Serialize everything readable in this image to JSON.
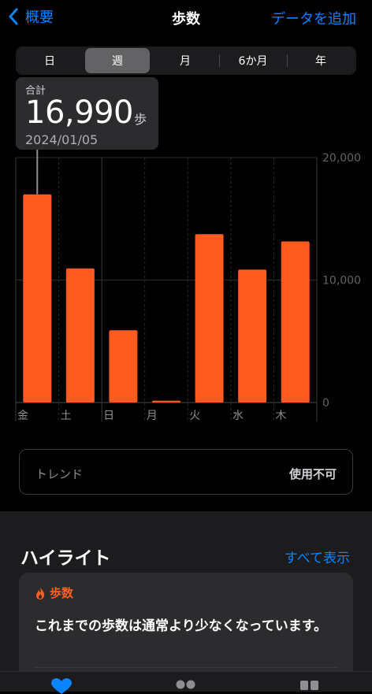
{
  "nav": {
    "back_label": "概要",
    "title": "歩数",
    "add_label": "データを追加"
  },
  "segments": [
    {
      "label": "日",
      "selected": false
    },
    {
      "label": "週",
      "selected": true
    },
    {
      "label": "月",
      "selected": false
    },
    {
      "label": "6か月",
      "selected": false
    },
    {
      "label": "年",
      "selected": false
    }
  ],
  "tooltip": {
    "label": "合計",
    "value": "16,990",
    "unit": "歩",
    "date": "2024/01/05"
  },
  "chart_data": {
    "type": "bar",
    "categories": [
      "金",
      "土",
      "日",
      "月",
      "火",
      "水",
      "木"
    ],
    "values": [
      16990,
      10950,
      5900,
      150,
      13750,
      10850,
      13150
    ],
    "ylim": [
      0,
      20000
    ],
    "yticks": [
      "0",
      "10,000",
      "20,000"
    ],
    "selected_index": 0,
    "bar_color": "#ff5a1f",
    "grid": true
  },
  "trend": {
    "label": "トレンド",
    "value": "使用不可"
  },
  "highlights": {
    "title": "ハイライト",
    "show_all": "すべて表示",
    "card": {
      "category": "歩数",
      "text": "これまでの歩数は通常より少なくなっています。"
    }
  },
  "colors": {
    "accent": "#0a84ff",
    "orange": "#ff5a1f"
  }
}
